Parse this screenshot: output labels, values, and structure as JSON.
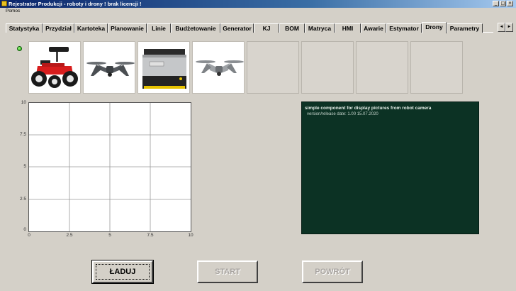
{
  "window": {
    "title": "Rejestrator Produkcji - roboty i drony   ! brak licencji !",
    "controls": [
      "_",
      "□",
      "×"
    ]
  },
  "menu": {
    "items": [
      "Pomoc"
    ]
  },
  "tabs": [
    "Statystyka",
    "Przydział",
    "Kartoteka",
    "Planowanie",
    "Linie",
    "Budżetowanie",
    "Generator",
    "KJ",
    "BOM",
    "Matryca",
    "HMI",
    "Awarie",
    "Estymator",
    "Drony",
    "Parametry"
  ],
  "active_tab": "Drony",
  "tab_scroll": {
    "left": "◄",
    "right": "►"
  },
  "status_indicator": {
    "color": "#2bb515"
  },
  "thumbnails": [
    {
      "content": "ground robot with camera",
      "filled": true
    },
    {
      "content": "quadcopter drone",
      "filled": true
    },
    {
      "content": "mobile robot platform",
      "filled": true
    },
    {
      "content": "quadcopter drone",
      "filled": true
    },
    {
      "content": "",
      "filled": false
    },
    {
      "content": "",
      "filled": false
    },
    {
      "content": "",
      "filled": false
    },
    {
      "content": "",
      "filled": false
    }
  ],
  "graph": {
    "y_ticks": [
      "10",
      "7.5",
      "5",
      "2.5",
      "0"
    ],
    "x_ticks": [
      "0",
      "2.5",
      "5",
      "7.5",
      "10"
    ],
    "xlim": [
      0,
      10
    ],
    "ylim": [
      0,
      10
    ],
    "grid": true
  },
  "info_panel": {
    "title": "simple component for display pictures from robot camera",
    "version_line": "version/release date:  1.00  15.07.2020",
    "background": "#0c3224"
  },
  "buttons": {
    "load": "ŁADUJ",
    "start": "START",
    "back": "POWRÓT"
  }
}
